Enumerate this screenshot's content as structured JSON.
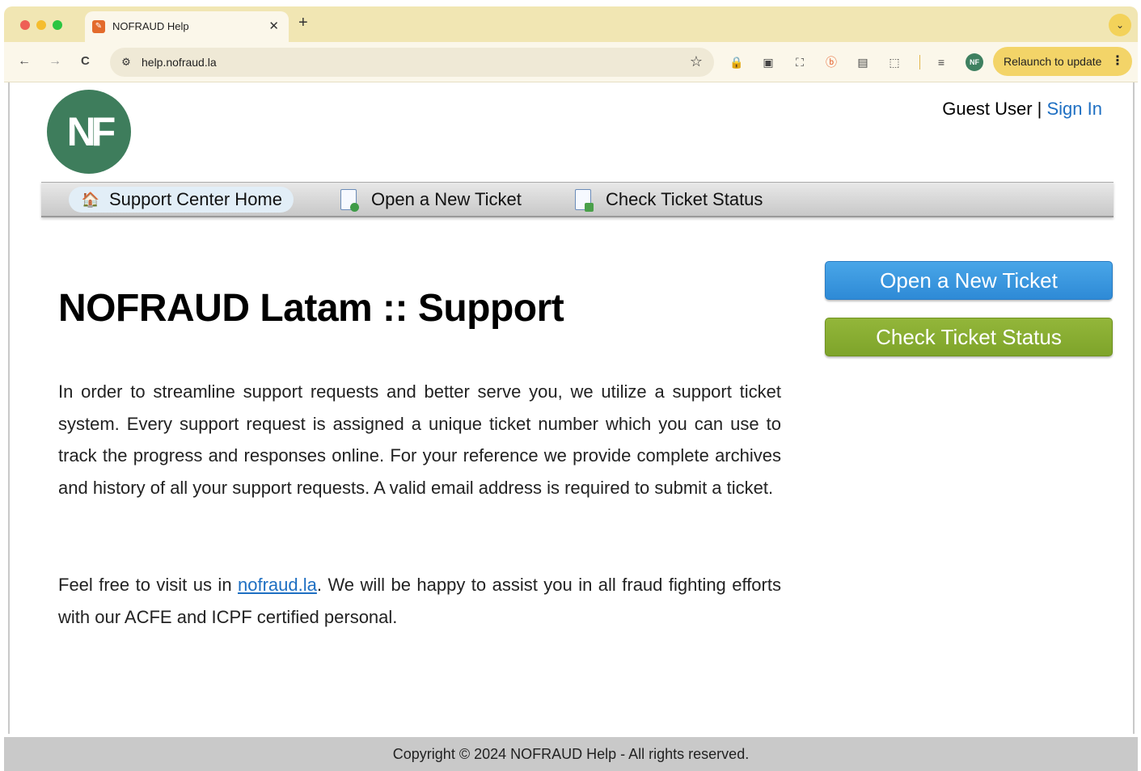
{
  "browser": {
    "tab_title": "NOFRAUD Help",
    "tab_close": "✕",
    "new_tab": "+",
    "tab_search": "⌄",
    "url": "help.nofraud.la",
    "relaunch_label": "Relaunch to update",
    "relaunch_menu": "⋮",
    "profile_initials": "NF",
    "nav": {
      "back": "←",
      "forward": "→",
      "reload": "C"
    },
    "star": "☆",
    "extensions": [
      "🔒",
      "▣",
      "⛶",
      "ⓑ",
      "▤",
      "⬚",
      "≡"
    ]
  },
  "header": {
    "logo_text": "NF",
    "guest_label": "Guest User",
    "separator": "|",
    "sign_in_label": "Sign In"
  },
  "nav": {
    "home_label": "Support Center Home",
    "open_ticket_label": "Open a New Ticket",
    "check_status_label": "Check Ticket Status"
  },
  "main": {
    "title": "NOFRAUD Latam :: Support",
    "intro": "In order to streamline support requests and better serve you, we utilize a support ticket system. Every support request is assigned a unique ticket number which you can use to track the progress and responses online. For your reference we provide complete archives and history of all your support requests. A valid email address is required to submit a ticket.",
    "visit_prefix": "Feel free to visit us in ",
    "visit_link": "nofraud.la",
    "visit_suffix": ". We will be happy to assist you in all fraud fighting efforts with our ACFE and ICPF certified personal."
  },
  "sidebar": {
    "open_ticket_button": "Open a New Ticket",
    "check_status_button": "Check Ticket Status"
  },
  "footer": {
    "copyright": "Copyright © 2024 NOFRAUD Help - All rights reserved."
  },
  "colors": {
    "logo_green": "#3e7d5c",
    "link_blue": "#1e6fc2",
    "button_blue": "#2e8ad6",
    "button_green": "#7ea42a"
  }
}
